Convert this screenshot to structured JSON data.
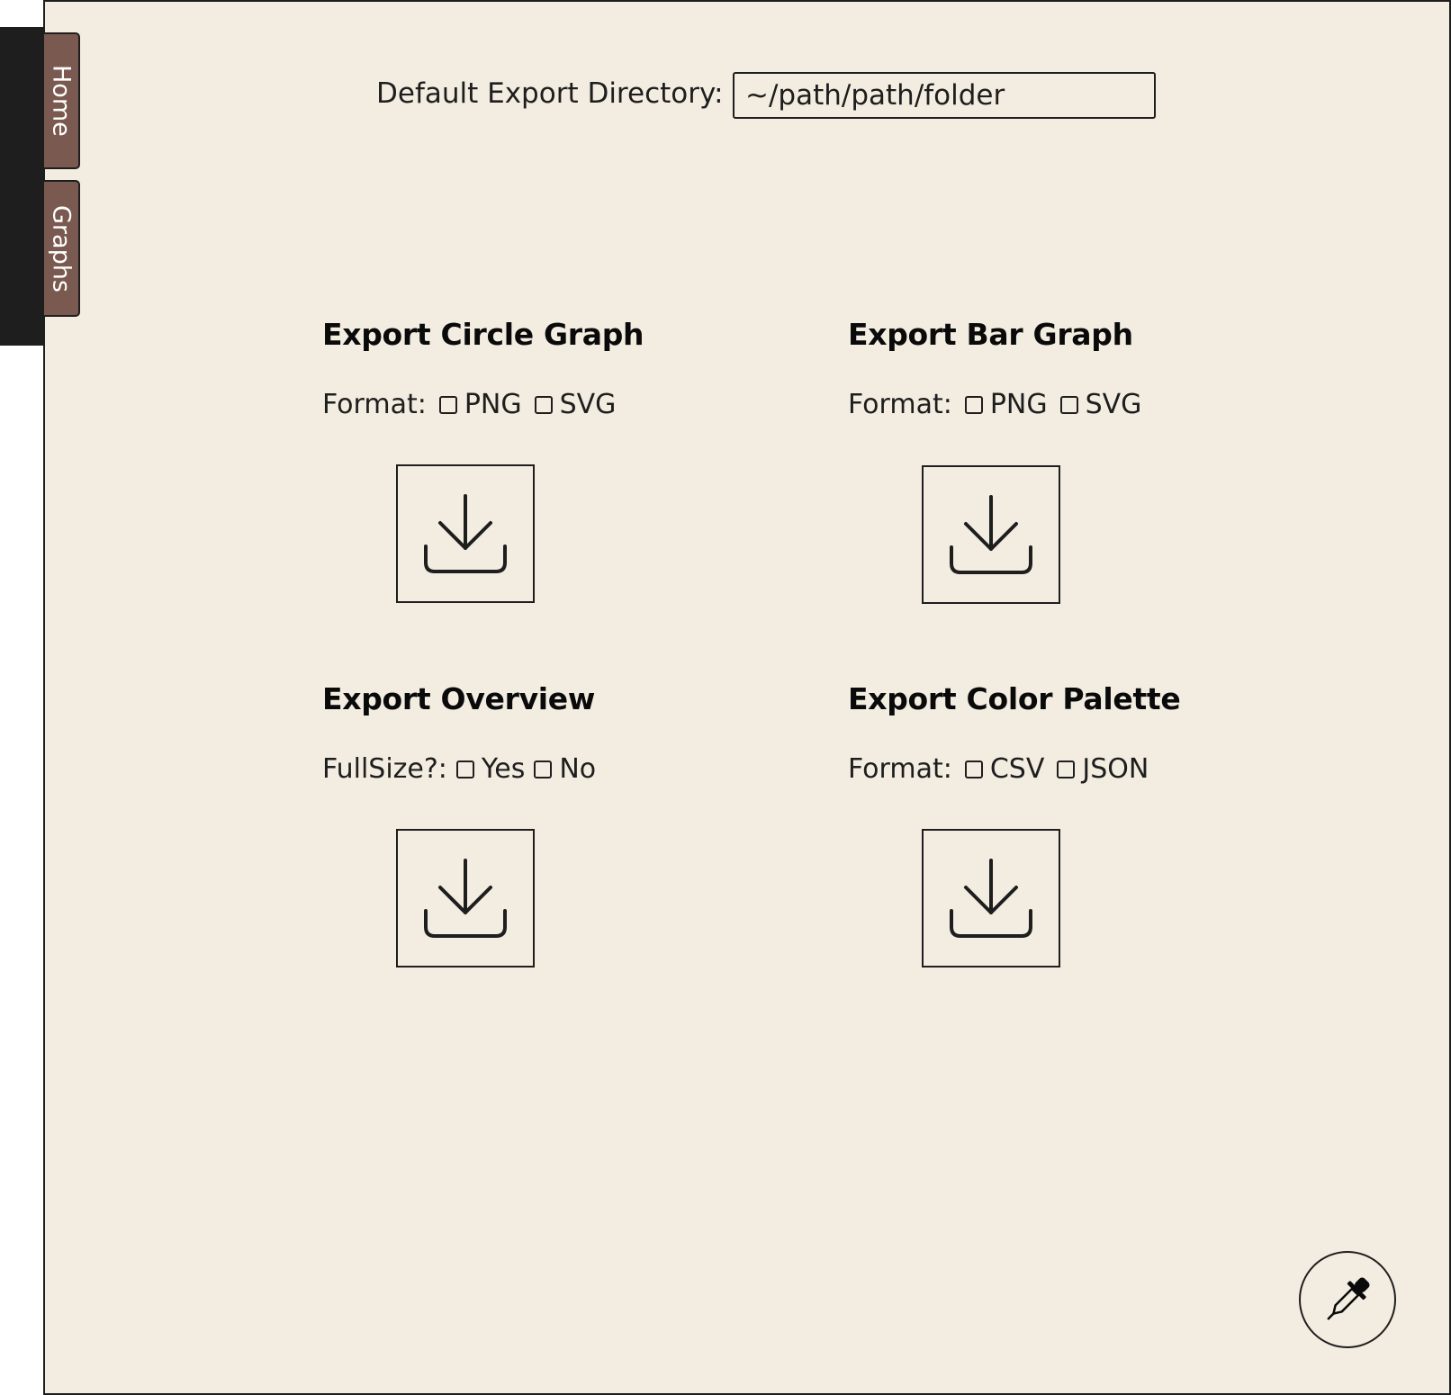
{
  "nav": {
    "tabs": [
      {
        "label": "Home"
      },
      {
        "label": "Graphs"
      }
    ]
  },
  "export_directory": {
    "label": "Default Export Directory:",
    "value": "~/path/path/folder"
  },
  "sections": {
    "circle_graph": {
      "title": "Export Circle Graph",
      "option_label": "Format:",
      "options": [
        "PNG",
        "SVG"
      ],
      "button_icon": "download-icon"
    },
    "bar_graph": {
      "title": "Export Bar Graph",
      "option_label": "Format:",
      "options": [
        "PNG",
        "SVG"
      ],
      "button_icon": "download-icon"
    },
    "overview": {
      "title": "Export Overview",
      "option_label": "FullSize?:",
      "options": [
        "Yes",
        "No"
      ],
      "button_icon": "download-icon"
    },
    "color_palette": {
      "title": "Export Color Palette",
      "option_label": "Format:",
      "options": [
        "CSV",
        "JSON"
      ],
      "button_icon": "download-icon"
    }
  },
  "fab": {
    "icon": "eyedropper-icon"
  },
  "colors": {
    "background": "#f3ede1",
    "tab": "#7a5a50",
    "rail": "#1e1e1e",
    "ink": "#1e1e1e"
  }
}
